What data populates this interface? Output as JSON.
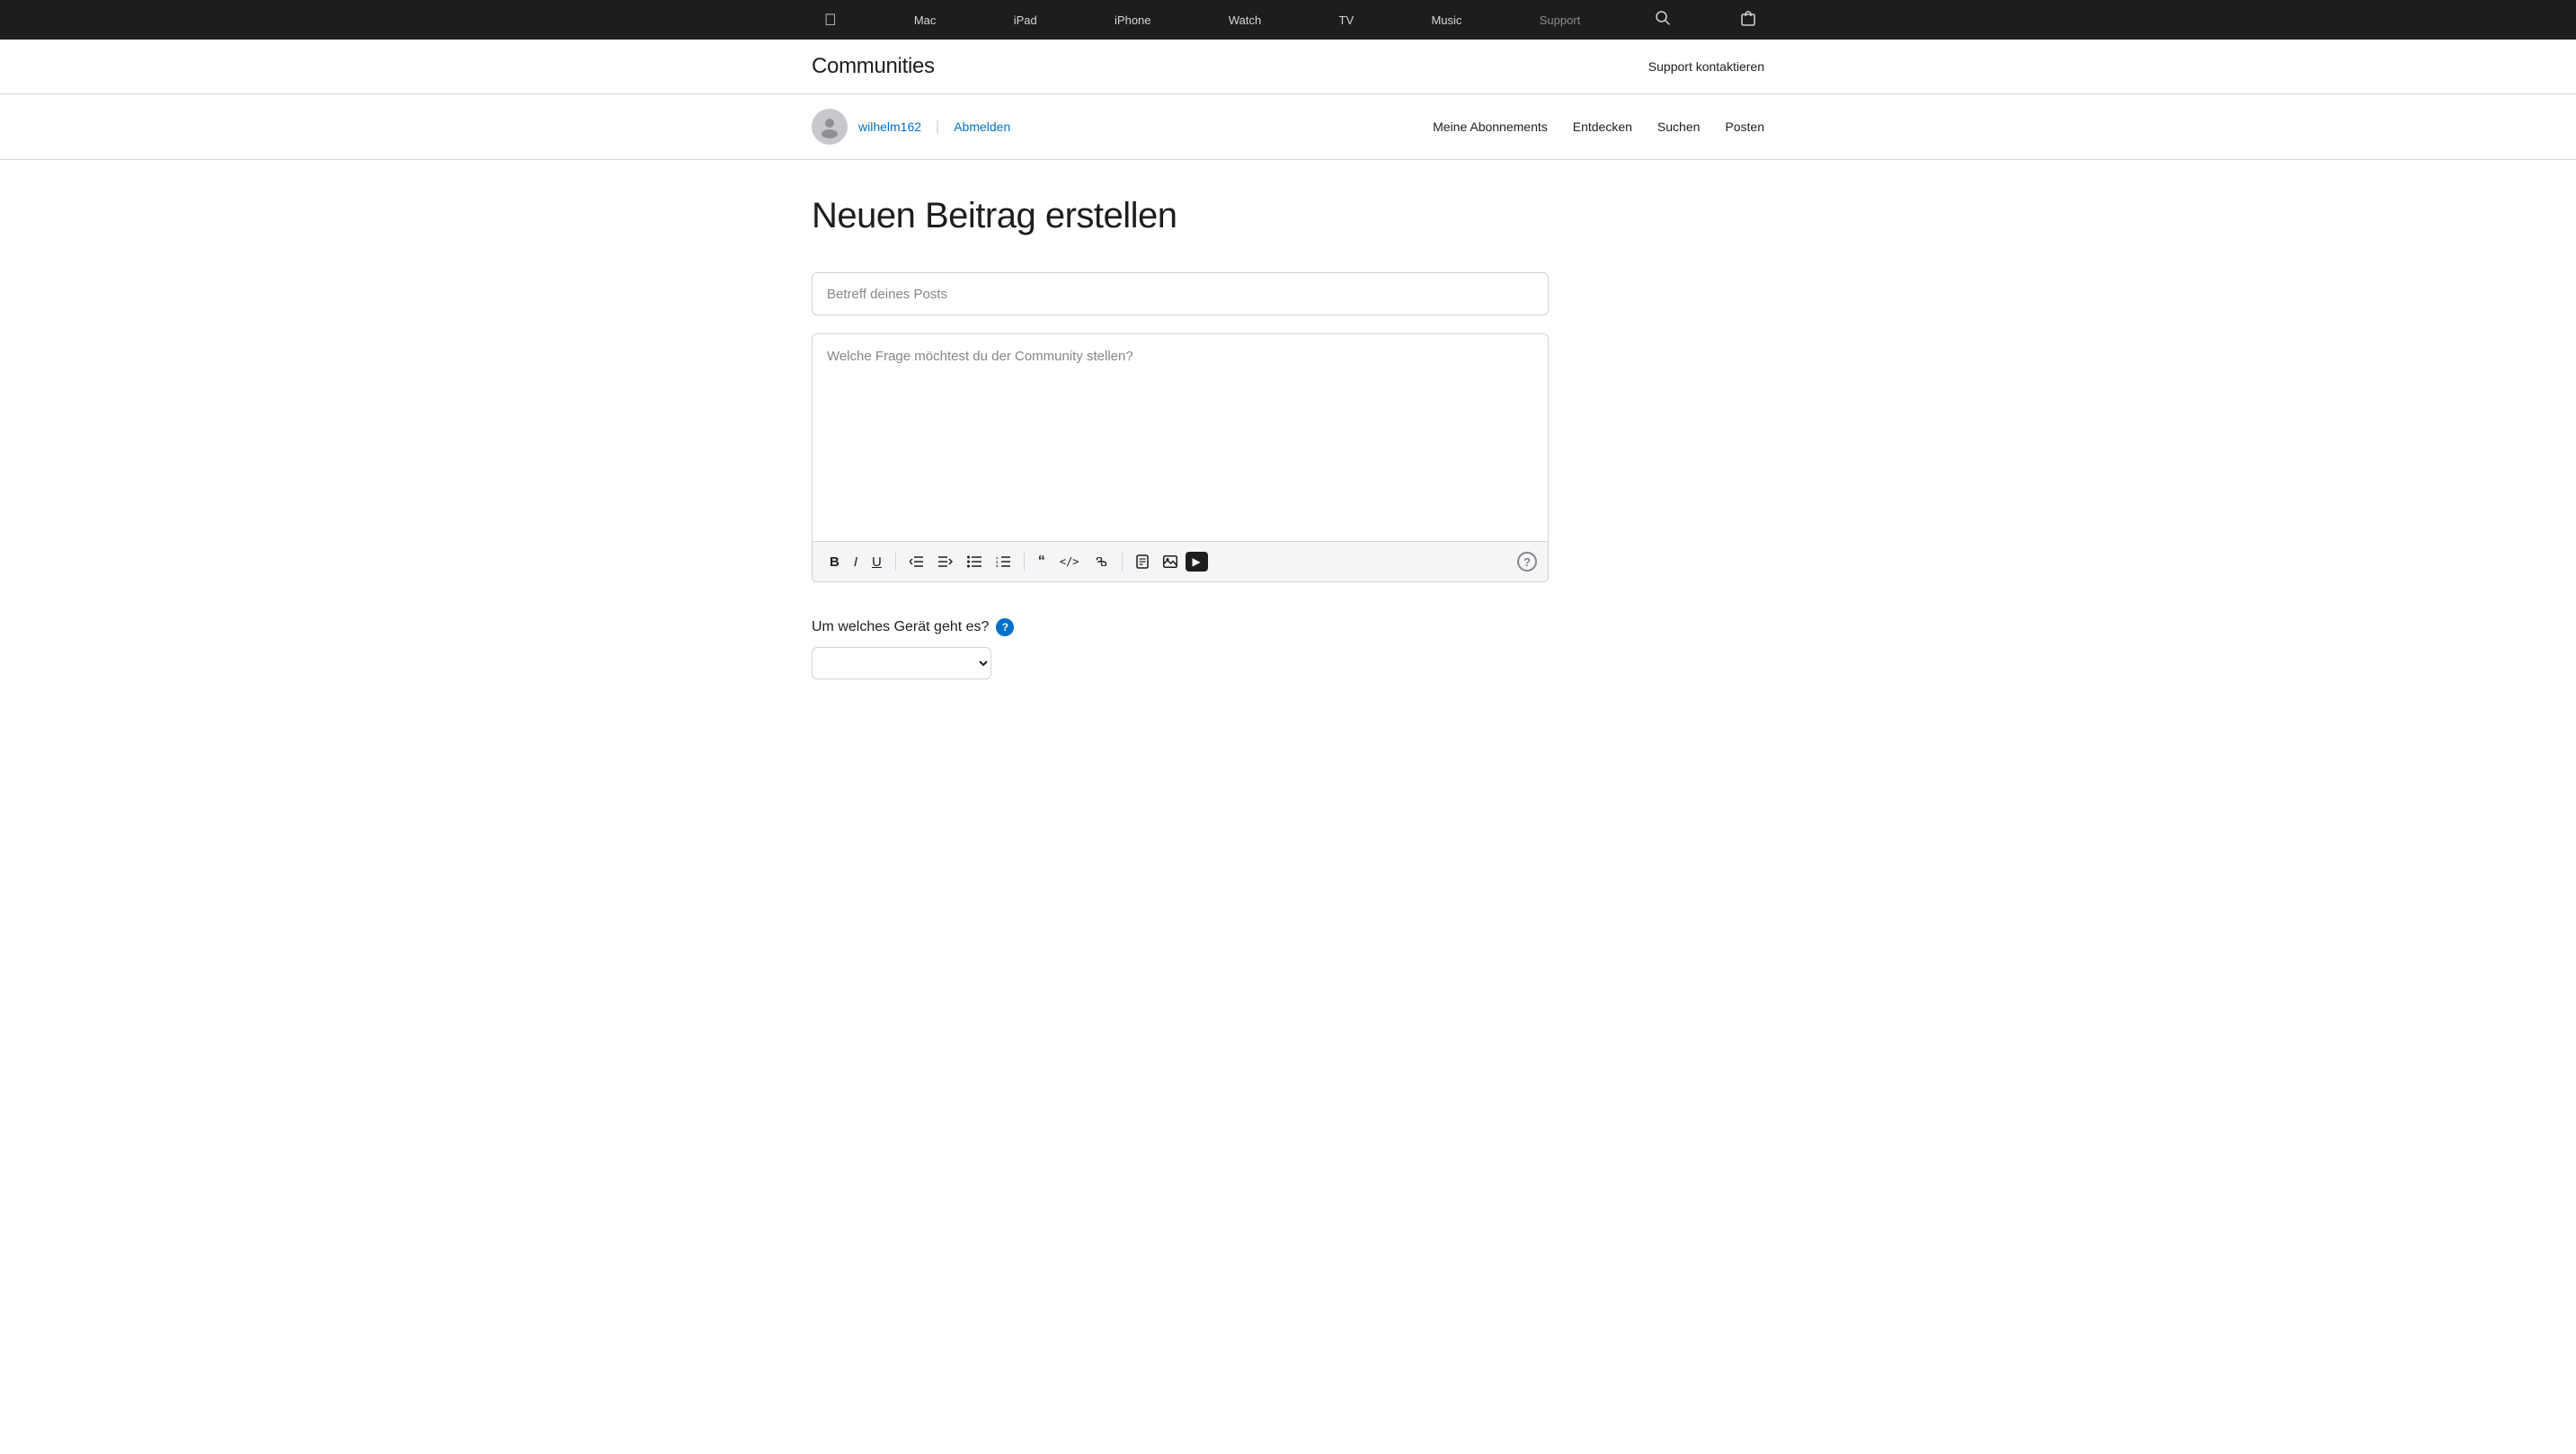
{
  "topnav": {
    "apple_logo": "",
    "items": [
      {
        "label": "Mac",
        "name": "mac"
      },
      {
        "label": "iPad",
        "name": "ipad"
      },
      {
        "label": "iPhone",
        "name": "iphone"
      },
      {
        "label": "Watch",
        "name": "watch"
      },
      {
        "label": "TV",
        "name": "tv"
      },
      {
        "label": "Music",
        "name": "music"
      },
      {
        "label": "Support",
        "name": "support",
        "dimmed": true
      }
    ],
    "search_icon": "🔍",
    "bag_icon": "🛍"
  },
  "communities_header": {
    "title": "Communities",
    "support_link": "Support kontaktieren"
  },
  "user_bar": {
    "username": "wilhelm162",
    "abmelden": "Abmelden",
    "nav_items": [
      {
        "label": "Meine Abonnements"
      },
      {
        "label": "Entdecken"
      },
      {
        "label": "Suchen"
      },
      {
        "label": "Posten"
      }
    ]
  },
  "page": {
    "heading": "Neuen Beitrag erstellen",
    "subject_placeholder": "Betreff deines Posts",
    "body_placeholder": "Welche Frage möchtest du der Community stellen?",
    "toolbar": {
      "bold": "B",
      "italic": "I",
      "underline": "U",
      "outdent": "«",
      "indent": "»",
      "bullet_list": "☰",
      "ordered_list": "≡",
      "blockquote": "❝",
      "code": "</>",
      "link": "🔗",
      "document": "📄",
      "image": "🖼",
      "play": "▶",
      "help": "?"
    },
    "device_section": {
      "label": "Um welches Gerät geht es?",
      "help_tooltip": "?",
      "dropdown_placeholder": ""
    }
  }
}
